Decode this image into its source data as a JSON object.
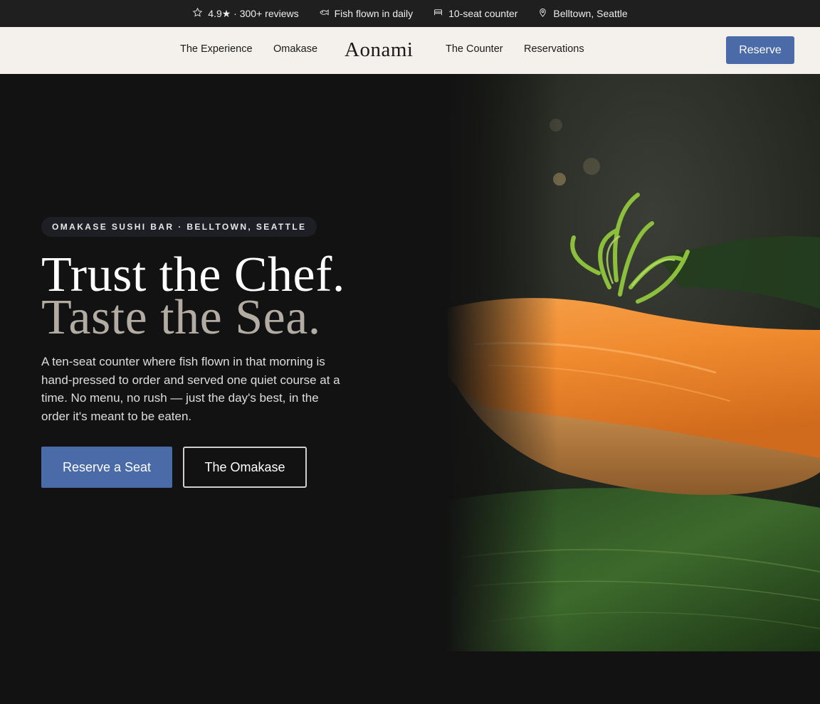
{
  "topbar": {
    "rating": "4.9★ · 300+ reviews",
    "fish": "Fish flown in daily",
    "seats": "10-seat counter",
    "location": "Belltown, Seattle"
  },
  "nav": {
    "logo": "Aonami",
    "links": [
      "The Experience",
      "Omakase",
      "The Counter",
      "Reservations"
    ],
    "reserve": "Reserve"
  },
  "hero": {
    "badge": "OMAKASE SUSHI BAR · BELLTOWN, SEATTLE",
    "headline_1": "Trust the Chef.",
    "headline_2": "Taste the Sea.",
    "description": "A ten-seat counter where fish flown in that morning is hand-pressed to order and served one quiet course at a time. No menu, no rush — just the day's best, in the order it's meant to be eaten.",
    "primary_cta": "Reserve a Seat",
    "secondary_cta": "The Omakase"
  },
  "colors": {
    "accent": "#4a6ba8",
    "background": "#121212",
    "nav_background": "#f4f1ec",
    "headline_secondary": "#b2aca3"
  },
  "icons": [
    "star-icon",
    "fish-icon",
    "seat-icon",
    "location-pin-icon"
  ]
}
